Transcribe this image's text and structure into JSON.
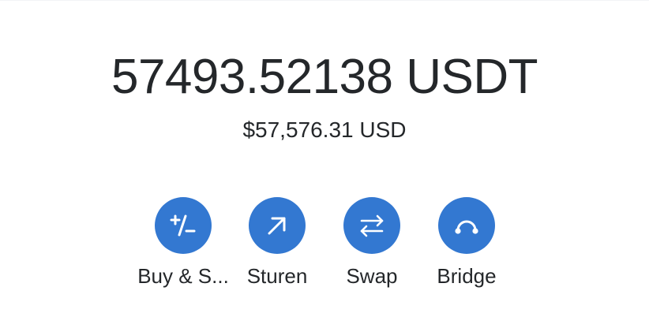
{
  "balance": {
    "token_amount": "57493.52138 USDT",
    "fiat_amount": "$57,576.31 USD"
  },
  "actions": [
    {
      "label": "Buy & S...",
      "icon": "buy-sell-icon"
    },
    {
      "label": "Sturen",
      "icon": "send-arrow-icon"
    },
    {
      "label": "Swap",
      "icon": "swap-arrows-icon"
    },
    {
      "label": "Bridge",
      "icon": "bridge-icon"
    }
  ],
  "colors": {
    "accent": "#3378d1",
    "text": "#24272a",
    "background": "#ffffff"
  }
}
